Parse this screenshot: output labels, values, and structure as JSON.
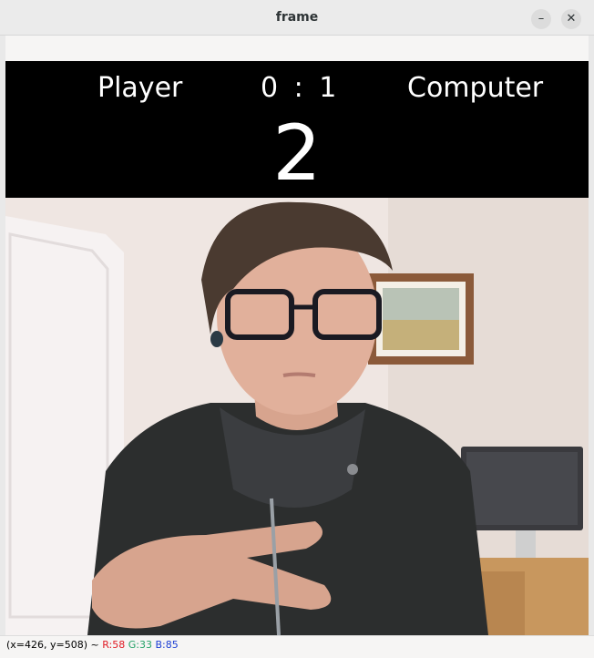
{
  "window": {
    "title": "frame"
  },
  "controls": {
    "minimize": "–",
    "close": "✕"
  },
  "scoreboard": {
    "player_label": "Player",
    "score": "0 : 1",
    "computer_label": "Computer",
    "countdown": "2"
  },
  "status": {
    "coords": "(x=426, y=508) ~ ",
    "r": "R:58",
    "g": "G:33",
    "b": "B:85"
  },
  "colors": {
    "score_bg": "#000000",
    "score_text": "#ffffff",
    "wall": "#efe6e2"
  }
}
